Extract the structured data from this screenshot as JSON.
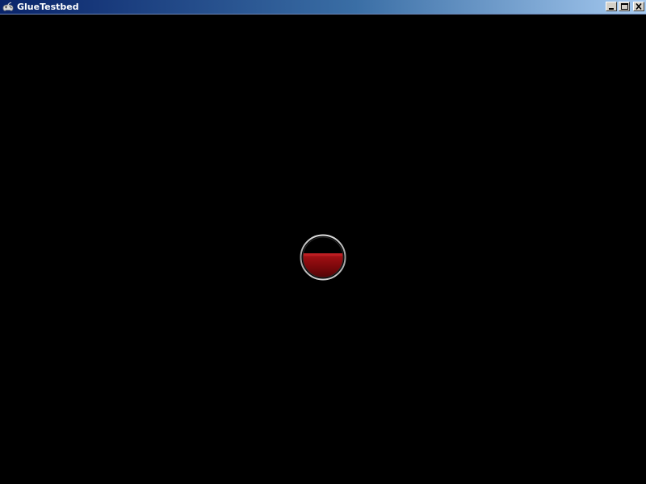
{
  "window": {
    "title": "GlueTestbed",
    "app_icon": "gamepad-icon",
    "controls": {
      "minimize_icon": "minimize-icon",
      "maximize_icon": "maximize-icon",
      "close_icon": "close-icon"
    }
  },
  "viewport": {
    "background": "#000000"
  },
  "orb": {
    "ring_color": "#c8c8c8",
    "fill_color": "#8a0c10",
    "highlight_color": "#b81a1e",
    "empty_color": "#000000",
    "fill_level": 0.6
  }
}
